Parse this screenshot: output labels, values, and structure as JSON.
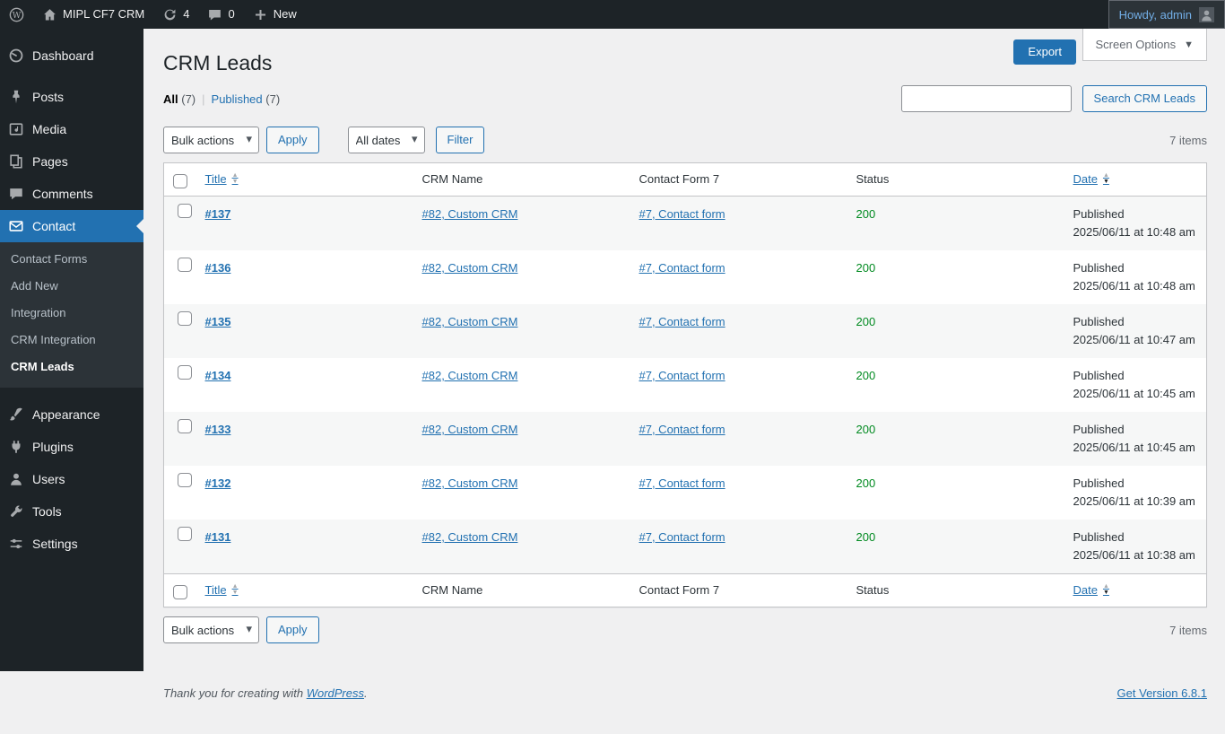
{
  "colors": {
    "accent": "#2271b1",
    "status_ok": "#008a20",
    "admin_bar_bg": "#1d2327",
    "content_bg": "#f0f0f1"
  },
  "admin_bar": {
    "logo_icon": "wordpress-logo-icon",
    "site_icon": "home-icon",
    "site_name": "MIPL CF7 CRM",
    "updates_icon": "updates-icon",
    "updates_count": "4",
    "comments_icon": "comments-bubble-icon",
    "comments_count": "0",
    "new_icon": "plus-icon",
    "new_label": "New",
    "account_label": "Howdy, admin",
    "avatar_icon": "avatar"
  },
  "sidebar": {
    "items": [
      {
        "label": "Dashboard",
        "icon": "dashboard-icon"
      },
      {
        "label": "Posts",
        "icon": "pushpin-icon"
      },
      {
        "label": "Media",
        "icon": "media-icon"
      },
      {
        "label": "Pages",
        "icon": "pages-icon"
      },
      {
        "label": "Comments",
        "icon": "comments-icon"
      },
      {
        "label": "Contact",
        "icon": "envelope-icon",
        "active": true
      },
      {
        "label": "Appearance",
        "icon": "brush-icon"
      },
      {
        "label": "Plugins",
        "icon": "plug-icon"
      },
      {
        "label": "Users",
        "icon": "person-icon"
      },
      {
        "label": "Tools",
        "icon": "wrench-icon"
      },
      {
        "label": "Settings",
        "icon": "sliders-icon"
      }
    ],
    "contact_submenu": [
      {
        "label": "Contact Forms"
      },
      {
        "label": "Add New"
      },
      {
        "label": "Integration"
      },
      {
        "label": "CRM Integration"
      },
      {
        "label": "CRM Leads",
        "current": true
      }
    ]
  },
  "header": {
    "page_title": "CRM Leads",
    "export_button": "Export",
    "screen_options": "Screen Options"
  },
  "views": {
    "all_label": "All",
    "all_count": "(7)",
    "separator": "|",
    "published_label": "Published",
    "published_count": "(7)"
  },
  "search": {
    "value": "",
    "button": "Search CRM Leads"
  },
  "tablenav": {
    "bulk_actions": "Bulk actions",
    "apply": "Apply",
    "all_dates": "All dates",
    "filter": "Filter",
    "items_count": "7 items"
  },
  "table": {
    "headers": {
      "title": "Title",
      "crm_name": "CRM Name",
      "contact_form": "Contact Form 7",
      "status": "Status",
      "date": "Date"
    },
    "rows": [
      {
        "title": "#137",
        "crm_name": "#82, Custom CRM",
        "contact_form": "#7, Contact form",
        "status": "200",
        "published": "Published",
        "date": "2025/06/11 at 10:48 am"
      },
      {
        "title": "#136",
        "crm_name": "#82, Custom CRM",
        "contact_form": "#7, Contact form",
        "status": "200",
        "published": "Published",
        "date": "2025/06/11 at 10:48 am"
      },
      {
        "title": "#135",
        "crm_name": "#82, Custom CRM",
        "contact_form": "#7, Contact form",
        "status": "200",
        "published": "Published",
        "date": "2025/06/11 at 10:47 am"
      },
      {
        "title": "#134",
        "crm_name": "#82, Custom CRM",
        "contact_form": "#7, Contact form",
        "status": "200",
        "published": "Published",
        "date": "2025/06/11 at 10:45 am"
      },
      {
        "title": "#133",
        "crm_name": "#82, Custom CRM",
        "contact_form": "#7, Contact form",
        "status": "200",
        "published": "Published",
        "date": "2025/06/11 at 10:45 am"
      },
      {
        "title": "#132",
        "crm_name": "#82, Custom CRM",
        "contact_form": "#7, Contact form",
        "status": "200",
        "published": "Published",
        "date": "2025/06/11 at 10:39 am"
      },
      {
        "title": "#131",
        "crm_name": "#82, Custom CRM",
        "contact_form": "#7, Contact form",
        "status": "200",
        "published": "Published",
        "date": "2025/06/11 at 10:38 am"
      }
    ]
  },
  "footer": {
    "thanks_text": "Thank you for creating with",
    "wordpress_link": "WordPress",
    "period": ".",
    "version_link": "Get Version 6.8.1"
  }
}
